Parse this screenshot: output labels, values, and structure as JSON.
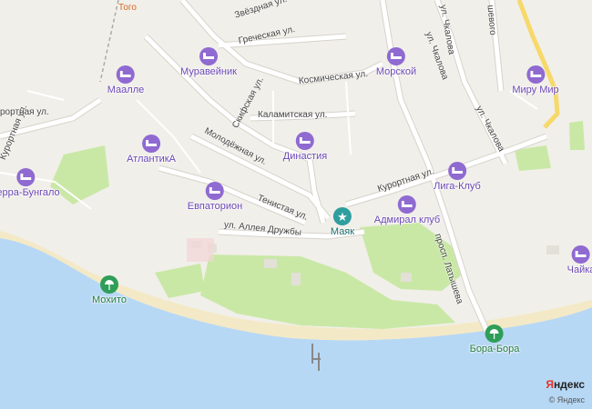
{
  "map": {
    "hotels": [
      {
        "name": "Муравейник"
      },
      {
        "name": "Маалле"
      },
      {
        "name": "АтлантикА"
      },
      {
        "name": "Евпаторион"
      },
      {
        "name": "Династия"
      },
      {
        "name": "Морской"
      },
      {
        "name": "Миру Мир"
      },
      {
        "name": "Лига-Клуб"
      },
      {
        "name": "Адмирал клуб"
      },
      {
        "name": "Терра-Бунгало"
      },
      {
        "name": "Чайка"
      }
    ],
    "sight": {
      "name": "Маяк"
    },
    "beaches": [
      {
        "name": "Мохито"
      },
      {
        "name": "Бора-Бора"
      }
    ],
    "streets": [
      "Звёздная ул.",
      "Греческая ул.",
      "Космическая ул.",
      "Скифская ул.",
      "Каламитская ул.",
      "Молодёжная ул.",
      "Курортная ул.",
      "Курортная ул.",
      "Тенистая ул.",
      "ул. Аллея Дружбы",
      "ул. Чкалова",
      "ул. Чкалова",
      "просп. Латышева",
      "ул. Чкалова"
    ],
    "fragments": [
      "Того",
      "рортная ул.",
      "шевого"
    ],
    "colors": {
      "water": "#b7d8f5",
      "land": "#f1efe9",
      "park": "#c9e8a6",
      "hotel": "#8f6ad1",
      "beach": "#2f9e58"
    }
  },
  "attribution": {
    "brand_red": "Я",
    "brand_rest": "ндекс",
    "copyright": "© Яндекс"
  }
}
